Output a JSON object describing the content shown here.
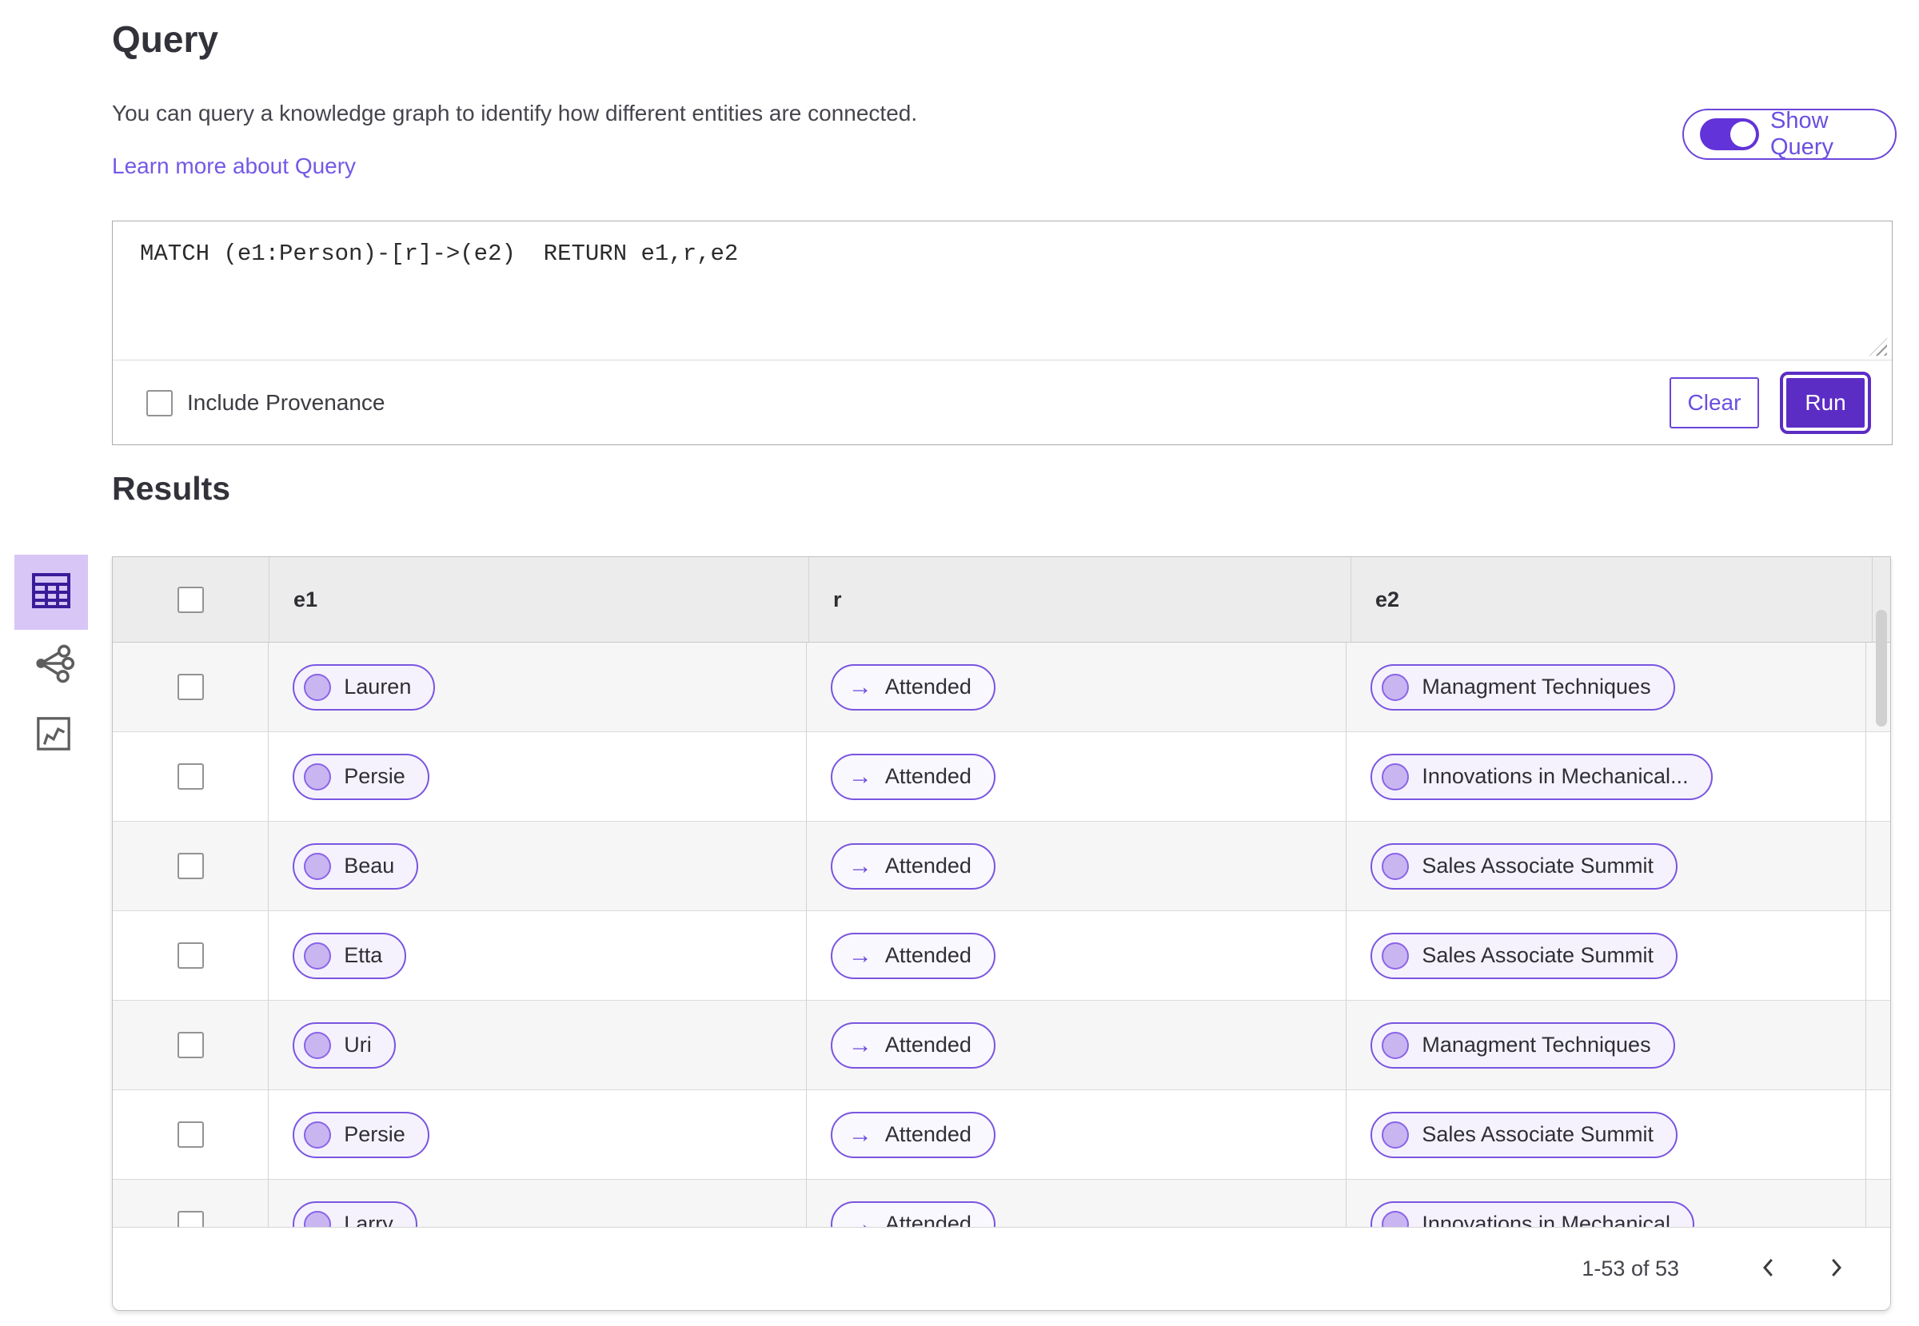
{
  "colors": {
    "accent": "#5c2dc4",
    "toggle_fill": "#6233d8",
    "pill_border": "#7a55e0",
    "link": "#7558e6",
    "selected_view_bg": "#d7c6f6",
    "selected_view_icon": "#3a1c99",
    "header_bg": "#ececec",
    "stripe_bg": "#f6f6f6"
  },
  "query_panel": {
    "title": "Query",
    "description": "You can query a knowledge graph to identify how different entities are connected.",
    "learn_more": "Learn more about Query",
    "show_query": "Show Query",
    "query_text": "MATCH (e1:Person)-[r]->(e2)  RETURN e1,r,e2",
    "include_provenance": "Include Provenance",
    "clear": "Clear",
    "run": "Run"
  },
  "results": {
    "title": "Results",
    "views": [
      {
        "name": "table-view",
        "selected": true
      },
      {
        "name": "graph-view",
        "selected": false
      },
      {
        "name": "chart-view",
        "selected": false
      }
    ],
    "columns": {
      "e1": "e1",
      "r": "r",
      "e2": "e2"
    },
    "rows": [
      {
        "e1": "Lauren",
        "r": "Attended",
        "e2": "Managment Techniques"
      },
      {
        "e1": "Persie",
        "r": "Attended",
        "e2": "Innovations in Mechanical..."
      },
      {
        "e1": "Beau",
        "r": "Attended",
        "e2": "Sales Associate Summit"
      },
      {
        "e1": "Etta",
        "r": "Attended",
        "e2": "Sales Associate Summit"
      },
      {
        "e1": "Uri",
        "r": "Attended",
        "e2": "Managment Techniques"
      },
      {
        "e1": "Persie",
        "r": "Attended",
        "e2": "Sales Associate Summit"
      },
      {
        "e1": "Larry",
        "r": "Attended",
        "e2": "Innovations in Mechanical"
      }
    ],
    "pagination": {
      "range": "1-53 of 53"
    },
    "relation_arrow": "→"
  }
}
